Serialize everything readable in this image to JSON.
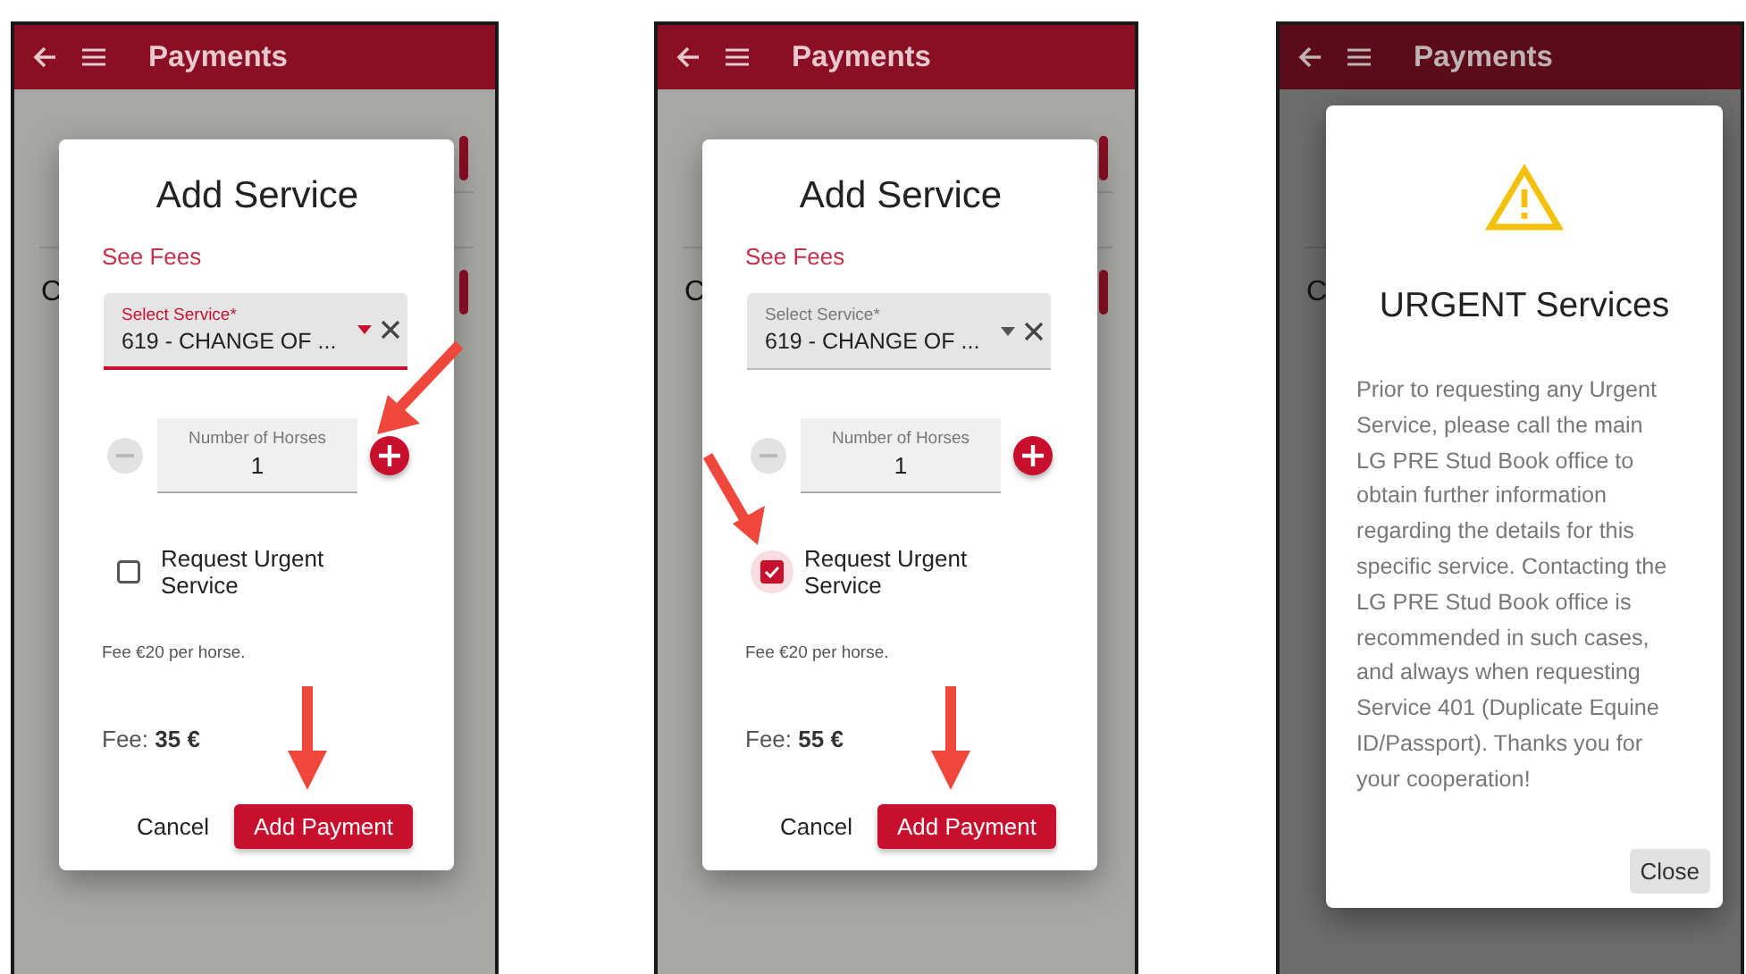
{
  "screens": [
    {
      "app_bar": {
        "title": "Payments"
      },
      "background_label": "C",
      "dialog": {
        "kind": "service_form",
        "title": "Add Service",
        "link": "See Fees",
        "select": {
          "label": "Select Service*",
          "value": "619 - CHANGE OF ...",
          "focused": true
        },
        "quantity": {
          "label": "Number of Horses",
          "value": "1"
        },
        "urgent": {
          "label": "Request Urgent Service",
          "checked": false
        },
        "note": "Fee €20 per horse.",
        "fee_label": "Fee:",
        "fee_value": "35 €",
        "buttons": [
          {
            "label": "Cancel",
            "kind": "text"
          },
          {
            "label": "Add Payment",
            "kind": "primary"
          }
        ]
      },
      "arrows": [
        {
          "kind": "increment"
        },
        {
          "kind": "submit"
        }
      ]
    },
    {
      "app_bar": {
        "title": "Payments"
      },
      "background_label": "C",
      "dialog": {
        "kind": "service_form",
        "title": "Add Service",
        "link": "See Fees",
        "select": {
          "label": "Select Service*",
          "value": "619 - CHANGE OF ...",
          "focused": false
        },
        "quantity": {
          "label": "Number of Horses",
          "value": "1"
        },
        "urgent": {
          "label": "Request Urgent Service",
          "checked": true
        },
        "note": "Fee €20 per horse.",
        "fee_label": "Fee:",
        "fee_value": "55 €",
        "buttons": [
          {
            "label": "Cancel",
            "kind": "text"
          },
          {
            "label": "Add Payment",
            "kind": "primary"
          }
        ]
      },
      "arrows": [
        {
          "kind": "checkbox"
        },
        {
          "kind": "submit"
        }
      ]
    },
    {
      "app_bar": {
        "title": "Payments"
      },
      "background_label": "C",
      "dialog": {
        "kind": "alert",
        "title": "URGENT Services",
        "message": "Prior to requesting any Urgent Service, please call the main LG PRE Stud Book office to obtain further information regarding the details for this specific service. Contacting the LG PRE Stud Book office is recommended in such cases, and always when requesting Service 401 (Duplicate Equine ID/Passport). Thanks you for your cooperation!",
        "buttons": [
          {
            "label": "Close",
            "kind": "flat"
          }
        ]
      }
    }
  ]
}
